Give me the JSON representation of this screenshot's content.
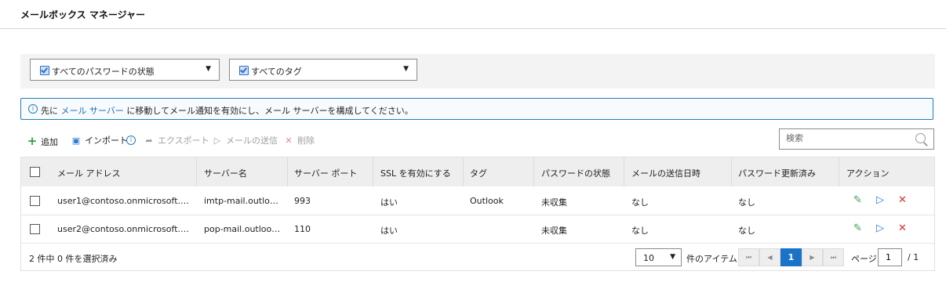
{
  "header": {
    "title": "メールボックス マネージャー"
  },
  "filters": {
    "password_state": "すべてのパスワードの状態",
    "tags": "すべてのタグ"
  },
  "info": {
    "prefix": "先に",
    "link": "メール サーバー",
    "suffix": "に移動してメール通知を有効にし、メール サーバーを構成してください。"
  },
  "toolbar": {
    "add": "追加",
    "import": "インポート",
    "export": "エクスポート",
    "send": "メールの送信",
    "delete": "削除"
  },
  "search": {
    "placeholder": "検索"
  },
  "table": {
    "columns": [
      "メール アドレス",
      "サーバー名",
      "サーバー ポート",
      "SSL を有効にする",
      "タグ",
      "パスワードの状態",
      "メールの送信日時",
      "パスワード更新済み",
      "アクション"
    ],
    "rows": [
      [
        "user1@contoso.onmicrosoft.…",
        "imtp-mail.outlo…",
        "993",
        "はい",
        "Outlook",
        "未収集",
        "なし",
        "なし"
      ],
      [
        "user2@contoso.onmicrosoft.…",
        "pop-mail.outloo…",
        "110",
        "はい",
        "",
        "未収集",
        "なし",
        "なし"
      ]
    ]
  },
  "footer": {
    "selection": "2 件中 0 件を選択済み",
    "page_size": "10",
    "items_label": "件のアイテム",
    "current_page": "1",
    "page_label": "ページ",
    "page_input": "1",
    "total_pages": "/ 1"
  },
  "colors": {
    "accent": "#1a73c8",
    "add_green": "#2e9e44",
    "edit_green": "#3aa15a",
    "send_blue": "#2b7bd1",
    "delete_red": "#d9302b"
  },
  "icons": [
    "info-icon",
    "plus-icon",
    "import-icon",
    "export-icon",
    "send-icon",
    "delete-icon",
    "search-icon",
    "edit-icon",
    "caret-down-icon"
  ]
}
